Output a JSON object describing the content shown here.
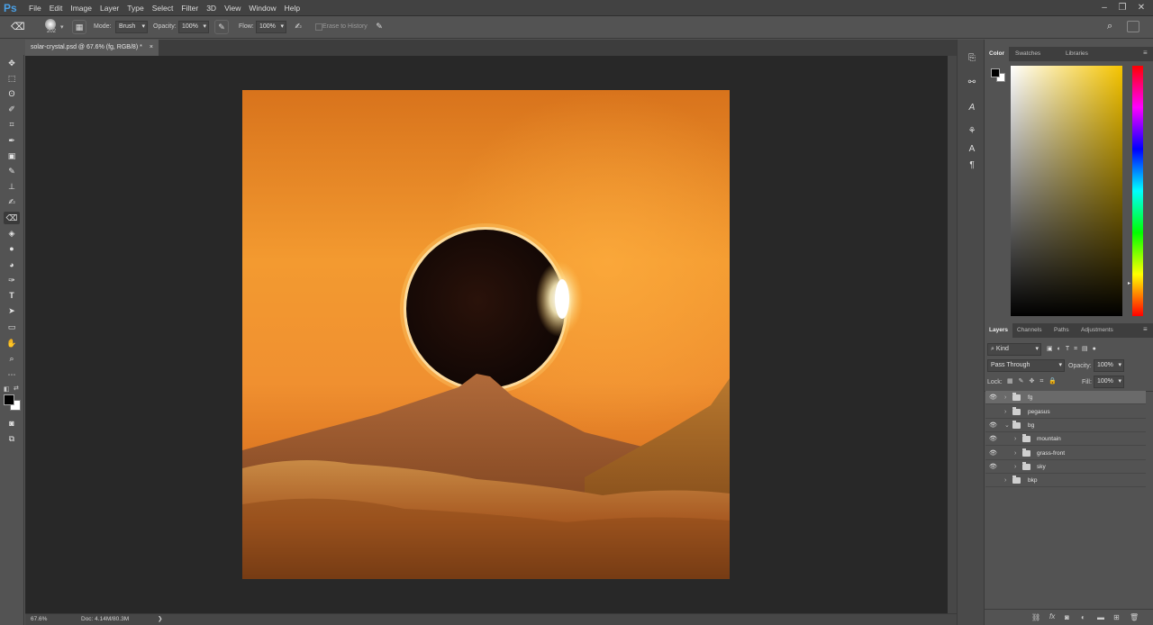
{
  "app": {
    "logo": "Ps"
  },
  "menu": [
    "File",
    "Edit",
    "Image",
    "Layer",
    "Type",
    "Select",
    "Filter",
    "3D",
    "View",
    "Window",
    "Help"
  ],
  "window_controls": {
    "minimize": "–",
    "restore": "❐",
    "close": "✕"
  },
  "options_bar": {
    "brush_size": "202",
    "mode_label": "Mode:",
    "mode_value": "Brush",
    "opacity_label": "Opacity:",
    "opacity_value": "100%",
    "flow_label": "Flow:",
    "flow_value": "100%",
    "erase_history_label": "Erase to History"
  },
  "document_tab": {
    "title": "solar-crystal.psd @ 67.6% (fg, RGB/8) *",
    "close": "×"
  },
  "status_bar": {
    "zoom": "67.6%",
    "doc_info": "Doc: 4.14M/80.3M",
    "arrow": "❯"
  },
  "color_panel": {
    "tabs": [
      "Color",
      "Swatches",
      "Libraries"
    ]
  },
  "layers_panel": {
    "tabs": [
      "Layers",
      "Channels",
      "Paths",
      "Adjustments"
    ],
    "kind_label": "Kind",
    "blend_mode": "Pass Through",
    "opacity_label": "Opacity:",
    "opacity_value": "100%",
    "lock_label": "Lock:",
    "fill_label": "Fill:",
    "fill_value": "100%",
    "layers": [
      {
        "name": "fg",
        "visible": true,
        "expanded": false,
        "indent": 0,
        "selected": true
      },
      {
        "name": "pegasus",
        "visible": false,
        "expanded": false,
        "indent": 0,
        "selected": false
      },
      {
        "name": "bg",
        "visible": true,
        "expanded": true,
        "indent": 0,
        "selected": false
      },
      {
        "name": "mountain",
        "visible": true,
        "expanded": false,
        "indent": 1,
        "selected": false
      },
      {
        "name": "grass-front",
        "visible": true,
        "expanded": false,
        "indent": 1,
        "selected": false
      },
      {
        "name": "sky",
        "visible": true,
        "expanded": false,
        "indent": 1,
        "selected": false
      },
      {
        "name": "bkp",
        "visible": false,
        "expanded": false,
        "indent": 0,
        "selected": false
      }
    ],
    "footer_icons": [
      "link-icon",
      "fx-icon",
      "mask-icon",
      "adjustment-icon",
      "group-icon",
      "new-layer-icon",
      "trash-icon"
    ],
    "footer_fx": "fx"
  },
  "colors": {
    "accent": "#4aa0e6",
    "sky_top": "#e1801f",
    "sky_mid": "#f59a2a",
    "grass": "#b9712f"
  }
}
